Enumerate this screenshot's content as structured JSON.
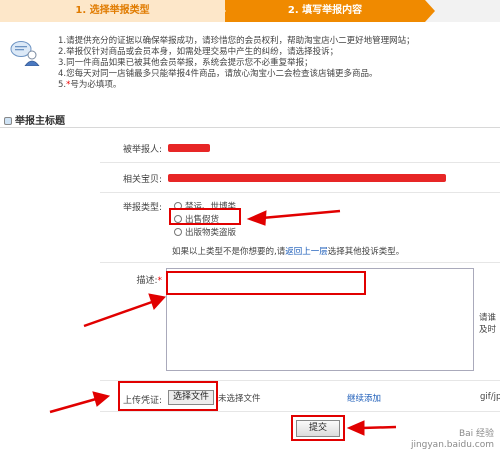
{
  "steps": {
    "step1": "1. 选择举报类型",
    "step2": "2. 填写举报内容"
  },
  "notice": {
    "line1": "1.请提供充分的证据以确保举报成功，请珍惜您的会员权利，帮助淘宝店小二更好地管理网站；",
    "line2": "2.举报仅针对商品或会员本身，如需处理交易中产生的纠纷，请选择投诉；",
    "line3": "3.同一件商品如果已被其他会员举报，系统会提示您不必重复举报；",
    "line4": "4.您每天对同一店铺最多只能举报4件商品，请放心淘宝小二会检查该店铺更多商品。",
    "line5_star": "5.",
    "line5_star_mark": "*",
    "line5_text": "号为必填项。"
  },
  "section_title": "举报主标题",
  "form": {
    "reported_label": "被举报人:",
    "item_label": "相关宝贝:",
    "type_label": "举报类型:",
    "options": [
      "禁运、世博类",
      "出售假货",
      "出版物类盗版"
    ],
    "hint_prefix": "如果以上类型不是你想要的,请",
    "hint_link": "返回上一层",
    "hint_suffix": "选择其他投诉类型。",
    "desc_label": "描述:",
    "required_mark": "*",
    "side_note": "请谁及时",
    "upload_label": "上传凭证:",
    "upload_button": "选择文件",
    "no_file": "未选择文件",
    "continue_add": "继续添加",
    "format_text": "gif/jp",
    "submit": "提交"
  },
  "watermark": {
    "line1": "Bai 经验",
    "line2": "jingyan.baidu.com"
  },
  "colors": {
    "step_active": "#f08a00",
    "step_inactive": "#fde7c9",
    "annotation_red": "#e10000",
    "link_blue": "#1a5bb8"
  }
}
